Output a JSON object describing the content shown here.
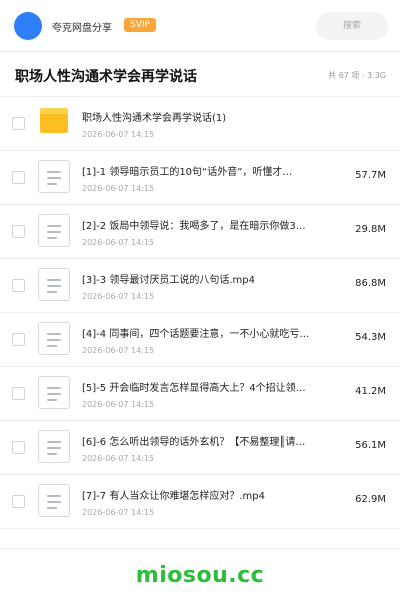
{
  "header": {
    "app_name": "夸克网盘分享",
    "badge": "SVIP",
    "search_placeholder": "搜索"
  },
  "folder": {
    "title": "职场人性沟通术学会再学说话",
    "summary": "共 67 项 · 3.3G"
  },
  "items": [
    {
      "type": "folder",
      "name": "职场人性沟通术学会再学说话(1)",
      "date": "2026-06-07 14:15",
      "size": ""
    },
    {
      "type": "file",
      "name": "[1]-1 领导暗示员工的10句“话外音”，听懂才…",
      "date": "2026-06-07 14:15",
      "size": "57.7M"
    },
    {
      "type": "file",
      "name": "[2]-2 饭局中领导说：我喝多了，是在暗示你做3…",
      "date": "2026-06-07 14:15",
      "size": "29.8M"
    },
    {
      "type": "file",
      "name": "[3]-3 领导最讨厌员工说的八句话.mp4",
      "date": "2026-06-07 14:15",
      "size": "86.8M"
    },
    {
      "type": "file",
      "name": "[4]-4 同事间，四个话题要注意，一不小心就吃亏…",
      "date": "2026-06-07 14:15",
      "size": "54.3M"
    },
    {
      "type": "file",
      "name": "[5]-5 开会临时发言怎样显得高大上？4个招让领…",
      "date": "2026-06-07 14:15",
      "size": "41.2M"
    },
    {
      "type": "file",
      "name": "[6]-6 怎么听出领导的话外玄机？【不易整理║请…",
      "date": "2026-06-07 14:15",
      "size": "56.1M"
    },
    {
      "type": "file",
      "name": "[7]-7 有人当众让你难堪怎样应对？.mp4",
      "date": "2026-06-07 14:15",
      "size": "62.9M"
    }
  ],
  "watermark": "miosou.cc",
  "colors": {
    "accent": "#2f7ff6",
    "svip": "#f8a638",
    "folder": "#fbbf23",
    "watermark": "#2dbd3a"
  }
}
